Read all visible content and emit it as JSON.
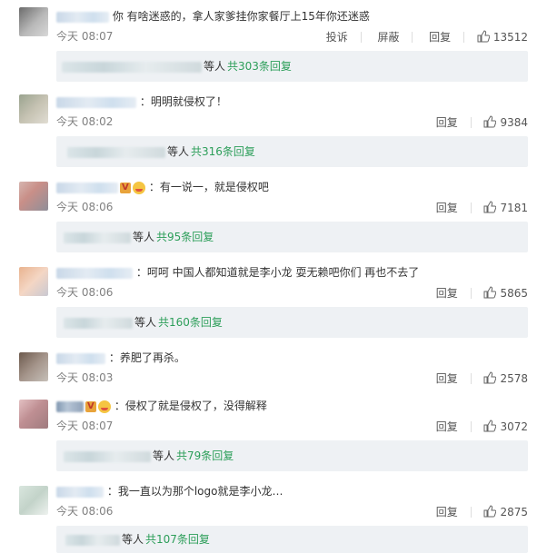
{
  "labels": {
    "report": "投诉",
    "hide": "屏蔽",
    "reply": "回复",
    "others": "等人"
  },
  "comments": [
    {
      "text": "你 有啥迷惑的，拿人家爹挂你家餐厅上15年你还迷惑",
      "time": "今天 08:07",
      "likes": "13512",
      "reply_summary": "共303条回复"
    },
    {
      "text": "：明明就侵权了！",
      "time": "今天 08:02",
      "likes": "9384",
      "reply_summary": "共316条回复"
    },
    {
      "text": "：有一说一，就是侵权吧",
      "time": "今天 08:06",
      "likes": "7181",
      "reply_summary": "共95条回复"
    },
    {
      "text": "：呵呵 中国人都知道就是李小龙 耍无赖吧你们 再也不去了",
      "time": "今天 08:06",
      "likes": "5865",
      "reply_summary": "共160条回复"
    },
    {
      "text": "：养肥了再杀。",
      "time": "今天 08:03",
      "likes": "2578",
      "reply_summary": ""
    },
    {
      "text": "：侵权了就是侵权了，没得解释",
      "time": "今天 08:07",
      "likes": "3072",
      "reply_summary": "共79条回复"
    },
    {
      "text": "：我一直以为那个logo就是李小龙…",
      "time": "今天 08:06",
      "likes": "2875",
      "reply_summary": "共107条回复"
    }
  ]
}
